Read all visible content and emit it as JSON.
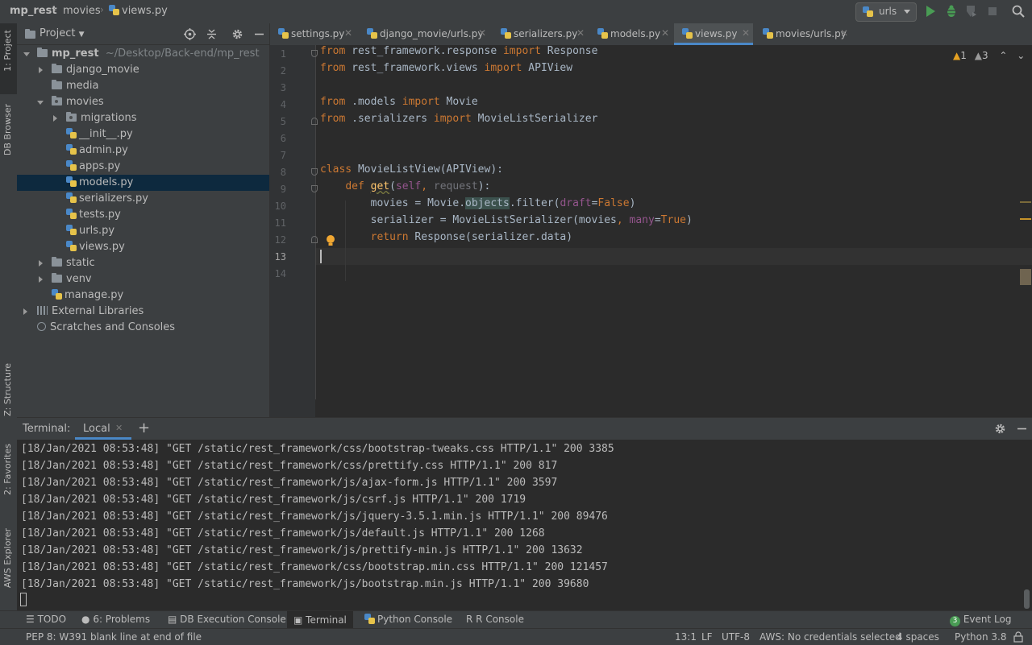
{
  "navbar": {
    "breadcrumbs": [
      "mp_rest",
      "movies",
      "views.py"
    ],
    "run_config": "urls"
  },
  "left_strip": {
    "project_tab": "1: Project",
    "db_browser_tab": "DB Browser",
    "structure_tab": "Z: Structure",
    "favorites_tab": "2: Favorites",
    "aws_tab": "AWS Explorer"
  },
  "project": {
    "title": "Project",
    "root_name": "mp_rest",
    "root_path": "~/Desktop/Back-end/mp_rest",
    "items": [
      {
        "label": "django_movie",
        "kind": "folder"
      },
      {
        "label": "media",
        "kind": "folder"
      },
      {
        "label": "movies",
        "kind": "folder"
      },
      {
        "label": "migrations",
        "kind": "folder"
      },
      {
        "label": "__init__.py",
        "kind": "py"
      },
      {
        "label": "admin.py",
        "kind": "py"
      },
      {
        "label": "apps.py",
        "kind": "py"
      },
      {
        "label": "models.py",
        "kind": "py"
      },
      {
        "label": "serializers.py",
        "kind": "py"
      },
      {
        "label": "tests.py",
        "kind": "py"
      },
      {
        "label": "urls.py",
        "kind": "py"
      },
      {
        "label": "views.py",
        "kind": "py"
      },
      {
        "label": "static",
        "kind": "folder"
      },
      {
        "label": "venv",
        "kind": "folder"
      },
      {
        "label": "manage.py",
        "kind": "py"
      },
      {
        "label": "External Libraries",
        "kind": "lib"
      },
      {
        "label": "Scratches and Consoles",
        "kind": "scratch"
      }
    ]
  },
  "tabs": [
    "settings.py",
    "django_movie/urls.py",
    "serializers.py",
    "models.py",
    "views.py",
    "movies/urls.py"
  ],
  "inspections": {
    "errors": "1",
    "warnings": "3"
  },
  "editor": {
    "line_numbers": [
      "1",
      "2",
      "3",
      "4",
      "5",
      "6",
      "7",
      "8",
      "9",
      "10",
      "11",
      "12",
      "13",
      "14"
    ],
    "l1": {
      "a": "from",
      "b": " rest_framework.response ",
      "c": "import",
      "d": " Response"
    },
    "l2": {
      "a": "from",
      "b": " rest_framework.views ",
      "c": "import",
      "d": " APIView"
    },
    "l4": {
      "a": "from",
      "b": " .models ",
      "c": "import",
      "d": " Movie"
    },
    "l5": {
      "a": "from",
      "b": " .serializers ",
      "c": "import",
      "d": " MovieListSerializer"
    },
    "l8": {
      "a": "class",
      "b": " MovieListView(APIView):"
    },
    "l9": {
      "indent": "    ",
      "a": "def",
      "sp": " ",
      "fn": "get",
      "p1": "(",
      "self": "self",
      "comma": ", ",
      "req": "request",
      "p2": "):"
    },
    "l10": {
      "indent": "        ",
      "a": "movies = Movie.",
      "obj": "objects",
      "b": ".filter(",
      "kwarg": "draft",
      "eq": "=",
      "val": "False",
      "c": ")"
    },
    "l11": {
      "indent": "        ",
      "a": "serializer = MovieListSerializer(movies",
      "comma": ", ",
      "kwarg": "many",
      "eq": "=",
      "val": "True",
      "c": ")"
    },
    "l12": {
      "indent": "        ",
      "a": "return",
      "b": " Response(serializer.data)"
    }
  },
  "terminal": {
    "label": "Terminal:",
    "tab": "Local",
    "lines": [
      "[18/Jan/2021 08:53:48] \"GET /static/rest_framework/css/bootstrap-tweaks.css HTTP/1.1\" 200 3385",
      "[18/Jan/2021 08:53:48] \"GET /static/rest_framework/css/prettify.css HTTP/1.1\" 200 817",
      "[18/Jan/2021 08:53:48] \"GET /static/rest_framework/js/ajax-form.js HTTP/1.1\" 200 3597",
      "[18/Jan/2021 08:53:48] \"GET /static/rest_framework/js/csrf.js HTTP/1.1\" 200 1719",
      "[18/Jan/2021 08:53:48] \"GET /static/rest_framework/js/jquery-3.5.1.min.js HTTP/1.1\" 200 89476",
      "[18/Jan/2021 08:53:48] \"GET /static/rest_framework/js/default.js HTTP/1.1\" 200 1268",
      "[18/Jan/2021 08:53:48] \"GET /static/rest_framework/js/prettify-min.js HTTP/1.1\" 200 13632",
      "[18/Jan/2021 08:53:48] \"GET /static/rest_framework/css/bootstrap.min.css HTTP/1.1\" 200 121457",
      "[18/Jan/2021 08:53:48] \"GET /static/rest_framework/js/bootstrap.min.js HTTP/1.1\" 200 39680"
    ]
  },
  "bottom_tools": {
    "todo": "TODO",
    "problems": "6: Problems",
    "db_console": "DB Execution Console",
    "terminal": "Terminal",
    "python_console": "Python Console",
    "r_console": "R Console",
    "event_log_count": "3",
    "event_log": "Event Log"
  },
  "status": {
    "message": "PEP 8: W391 blank line at end of file",
    "position": "13:1",
    "line_sep": "LF",
    "encoding": "UTF-8",
    "aws": "AWS: No credentials selected",
    "indent": "4 spaces",
    "interpreter": "Python 3.8"
  },
  "colors": {
    "accent": "#4a88c7",
    "selection": "#0d293e",
    "keyword": "#cc7832",
    "function": "#ffc66d"
  }
}
